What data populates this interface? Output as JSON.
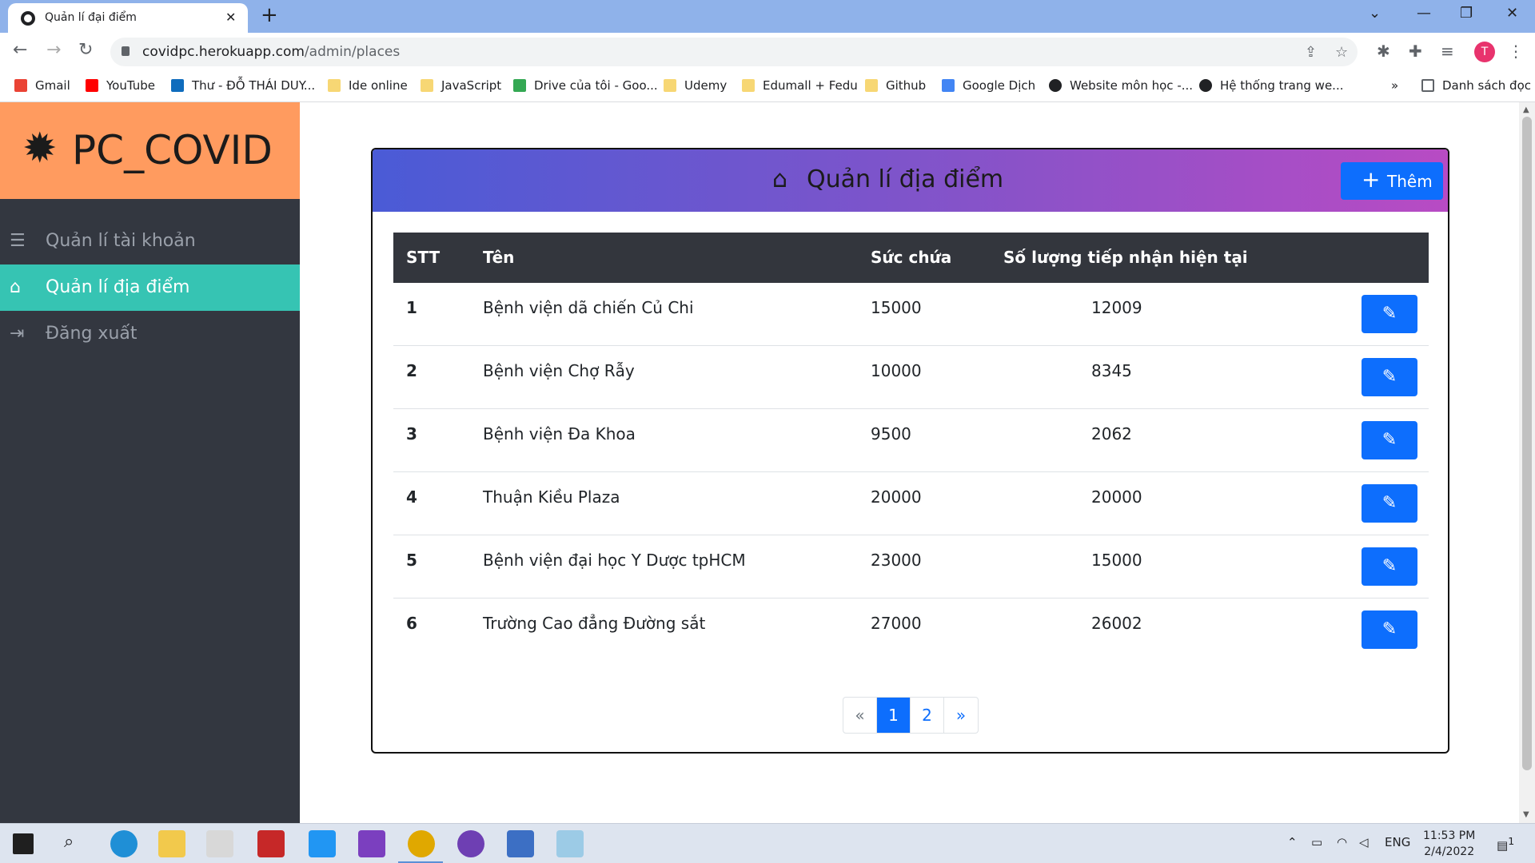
{
  "browser": {
    "tab_title": "Quản lí đại điểm",
    "url_domain": "covidpc.herokuapp.com",
    "url_path": "/admin/places",
    "avatar_letter": "T",
    "bookmarks": [
      "Gmail",
      "YouTube",
      "Thư - ĐỖ THÁI DUY...",
      "Ide online",
      "JavaScript",
      "Drive của tôi - Goo...",
      "Udemy",
      "Edumall + Fedu",
      "Github",
      "Google Dịch",
      "Website môn học -...",
      "Hệ thống trang we..."
    ],
    "reading_list": "Danh sách đọc",
    "more_bookmarks": "»"
  },
  "sidebar": {
    "brand": "PC_COVID",
    "items": [
      {
        "label": "Quản lí tài khoản",
        "icon": "list-check-icon",
        "active": false
      },
      {
        "label": "Quản lí địa điểm",
        "icon": "clinic-medical-icon",
        "active": true
      },
      {
        "label": "Đăng xuất",
        "icon": "sign-out-icon",
        "active": false
      }
    ]
  },
  "card": {
    "title": "Quản lí địa điểm",
    "title_icon": "clinic-medical-icon",
    "add_label": "Thêm"
  },
  "table": {
    "headers": [
      "STT",
      "Tên",
      "Sức chứa",
      "Số lượng tiếp nhận hiện tại"
    ],
    "rows": [
      {
        "stt": "1",
        "name": "Bệnh viện dã chiến Củ Chi",
        "capacity": "15000",
        "current": "12009"
      },
      {
        "stt": "2",
        "name": "Bệnh viện Chợ Rẫy",
        "capacity": "10000",
        "current": "8345"
      },
      {
        "stt": "3",
        "name": "Bệnh viện Đa Khoa",
        "capacity": "9500",
        "current": "2062"
      },
      {
        "stt": "4",
        "name": "Thuận Kiều Plaza",
        "capacity": "20000",
        "current": "20000"
      },
      {
        "stt": "5",
        "name": "Bệnh viện đại học Y Dược tpHCM",
        "capacity": "23000",
        "current": "15000"
      },
      {
        "stt": "6",
        "name": "Trường Cao đẳng Đường sắt",
        "capacity": "27000",
        "current": "26002"
      }
    ]
  },
  "pagination": {
    "prev": "«",
    "pages": [
      "1",
      "2"
    ],
    "active": "1",
    "next": "»"
  },
  "taskbar": {
    "language": "ENG",
    "time": "11:53 PM",
    "date": "2/4/2022",
    "notification_count": "1"
  },
  "colors": {
    "brand": "#ff9b5f",
    "sidebar": "#333740",
    "active": "#36c4b3",
    "primary": "#0d6efd",
    "header_gradient_start": "#4a5bd6",
    "header_gradient_end": "#b84bc4"
  }
}
